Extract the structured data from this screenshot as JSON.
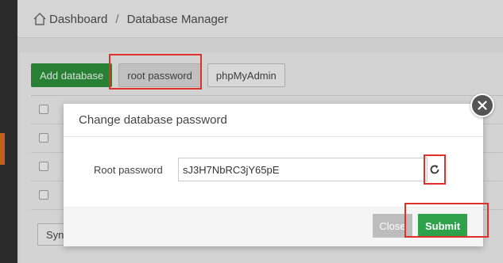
{
  "breadcrumb": {
    "home_label": "Dashboard",
    "separator": "/",
    "current": "Database Manager"
  },
  "toolbar": {
    "add_database": "Add database",
    "root_password": "root password",
    "phpmyadmin": "phpMyAdmin"
  },
  "table": {
    "row_count": 4
  },
  "bottom": {
    "sync_label": "Sync"
  },
  "modal": {
    "title": "Change database password",
    "field_label": "Root password",
    "field_value": "sJ3H7NbRC3jY65pE",
    "close_label": "Close",
    "submit_label": "Submit"
  },
  "colors": {
    "primary_green": "#2ea24a",
    "highlight_red": "#e0302a"
  }
}
